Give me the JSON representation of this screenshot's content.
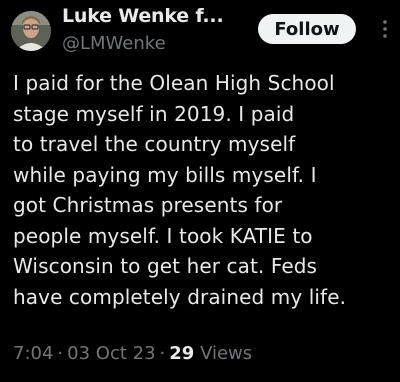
{
  "author": {
    "display_name": "Luke Wenke f...",
    "handle": "@LMWenke",
    "avatar_icon": "user-avatar-photo"
  },
  "follow_button": {
    "label": "Follow"
  },
  "more_icon": "more-vertical-icon",
  "tweet": {
    "lines": [
      "I paid for the Olean High School",
      "stage myself in 2019.  I paid",
      "to travel the country myself",
      "while paying my bills myself.  I",
      "got Christmas presents for",
      "people myself.  I took KATIE to",
      "Wisconsin to get her cat.  Feds",
      "have completely drained my life."
    ]
  },
  "meta": {
    "time": "7:04",
    "separator": "·",
    "date": "03 Oct 23",
    "views_count": "29",
    "views_label": "Views"
  },
  "colors": {
    "background": "#000000",
    "text_primary": "#e7e9ea",
    "text_secondary": "#71767b",
    "button_bg": "#eff3f4",
    "button_text": "#0f1419"
  }
}
